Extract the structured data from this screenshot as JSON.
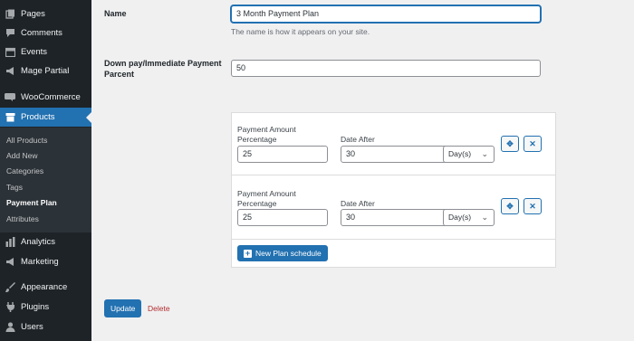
{
  "sidebar": {
    "items": [
      {
        "label": "Pages",
        "icon": "pages-icon"
      },
      {
        "label": "Comments",
        "icon": "comments-icon"
      },
      {
        "label": "Events",
        "icon": "calendar-icon"
      },
      {
        "label": "Mage Partial",
        "icon": "megaphone-icon"
      },
      {
        "label": "WooCommerce",
        "icon": "woo-icon"
      },
      {
        "label": "Products",
        "icon": "archive-icon"
      },
      {
        "label": "Analytics",
        "icon": "bar-chart-icon"
      },
      {
        "label": "Marketing",
        "icon": "megaphone-icon"
      },
      {
        "label": "Appearance",
        "icon": "brush-icon"
      },
      {
        "label": "Plugins",
        "icon": "plug-icon"
      },
      {
        "label": "Users",
        "icon": "user-icon"
      }
    ],
    "submenu": [
      "All Products",
      "Add New",
      "Categories",
      "Tags",
      "Payment Plan",
      "Attributes"
    ],
    "accent": "#2271b1"
  },
  "form": {
    "name_label": "Name",
    "name_value": "3 Month Payment Plan",
    "name_hint": "The name is how it appears on your site.",
    "downpay_label_line1": "Down pay/Immediate Payment",
    "downpay_label_line2": "Parcent",
    "downpay_value": "50"
  },
  "plan": {
    "rows": [
      {
        "pct_label_1": "Payment Amount",
        "pct_label_2": "Percentage",
        "pct_value": "25",
        "date_label": "Date After",
        "date_value": "30",
        "unit": "Day(s)"
      },
      {
        "pct_label_1": "Payment Amount",
        "pct_label_2": "Percentage",
        "pct_value": "25",
        "date_label": "Date After",
        "date_value": "30",
        "unit": "Day(s)"
      }
    ],
    "new_schedule_label": "New Plan schedule"
  },
  "actions": {
    "update_label": "Update",
    "delete_label": "Delete"
  }
}
